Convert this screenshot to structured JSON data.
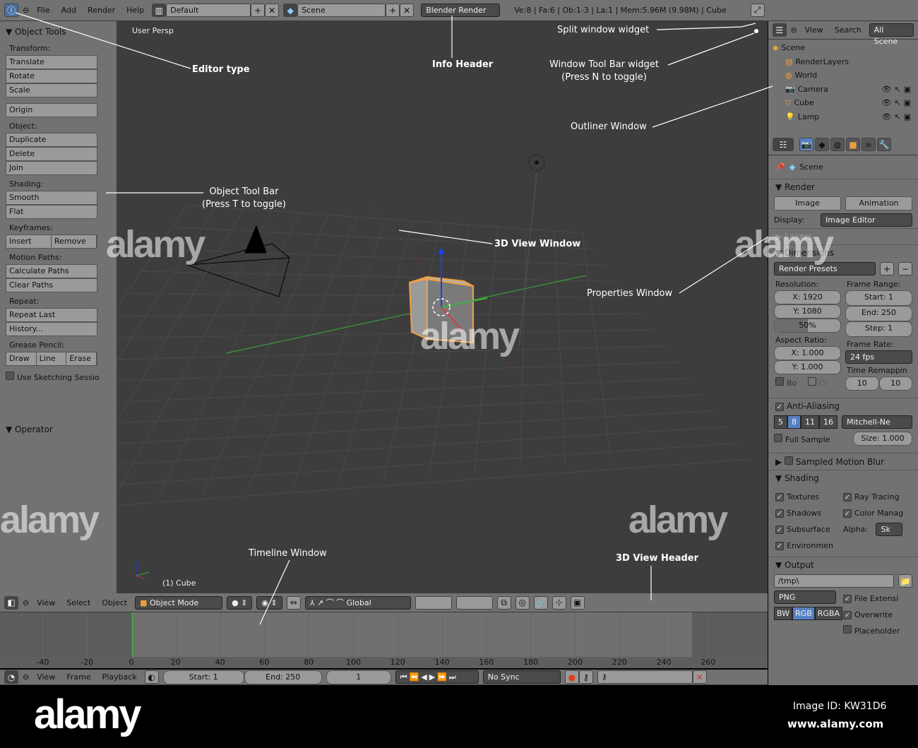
{
  "info_header": {
    "menus": [
      "File",
      "Add",
      "Render",
      "Help"
    ],
    "layout": "Default",
    "scene": "Scene",
    "engine": "Blender Render",
    "stats": "Ve:8 | Fa:6 | Ob:1-3 | La:1 | Mem:5.96M (9.98M) | Cube"
  },
  "toolbar": {
    "title": "Object Tools",
    "sections": [
      {
        "label": "Transform:",
        "buttons": [
          "Translate",
          "Rotate",
          "Scale"
        ]
      },
      {
        "label": "",
        "buttons": [
          "Origin"
        ]
      },
      {
        "label": "Object:",
        "buttons": [
          "Duplicate",
          "Delete",
          "Join"
        ]
      },
      {
        "label": "Shading:",
        "buttons": [
          "Smooth",
          "Flat"
        ]
      },
      {
        "label": "Keyframes:",
        "row": [
          "Insert",
          "Remove"
        ]
      },
      {
        "label": "Motion Paths:",
        "buttons": [
          "Calculate Paths",
          "Clear Paths"
        ]
      },
      {
        "label": "Repeat:",
        "buttons": [
          "Repeat Last",
          "History..."
        ]
      },
      {
        "label": "Grease Pencil:",
        "row": [
          "Draw",
          "Line",
          "Erase"
        ]
      }
    ],
    "sketching": "Use Sketching Sessio",
    "operator": "Operator"
  },
  "view3d": {
    "persp": "User Persp",
    "object_label": "(1) Cube"
  },
  "view3d_header": {
    "menus": [
      "View",
      "Select",
      "Object"
    ],
    "mode": "Object Mode",
    "orientation": "Global"
  },
  "timeline": {
    "ticks": [
      "-40",
      "-20",
      "0",
      "20",
      "40",
      "60",
      "80",
      "100",
      "120",
      "140",
      "160",
      "180",
      "200",
      "220",
      "240",
      "260"
    ],
    "current_frame": 0,
    "menus": [
      "View",
      "Frame",
      "Playback"
    ],
    "start": "Start: 1",
    "end": "End: 250",
    "frame": "1",
    "sync": "No Sync"
  },
  "outliner": {
    "menus": [
      "View",
      "Search"
    ],
    "filter": "All Scene",
    "items": [
      "Scene",
      "RenderLayers",
      "World",
      "Camera",
      "Cube",
      "Lamp"
    ]
  },
  "properties": {
    "context": "Scene",
    "render": {
      "title": "Render",
      "image": "Image",
      "animation": "Animation",
      "display_label": "Display:",
      "display": "Image Editor"
    },
    "layers": "Layers",
    "dimensions": {
      "title": "Dimensions",
      "presets": "Render Presets",
      "res_label": "Resolution:",
      "res_x": "X: 1920",
      "res_y": "Y: 1080",
      "res_pct": "50%",
      "res_pct_value": 50,
      "range_label": "Frame Range:",
      "start": "Start: 1",
      "end": "End: 250",
      "step": "Step: 1",
      "aspect_label": "Aspect Ratio:",
      "asp_x": "X: 1.000",
      "asp_y": "Y: 1.000",
      "rate_label": "Frame Rate:",
      "fps": "24 fps",
      "remap_label": "Time Remappin",
      "remap_a": "10",
      "remap_b": "10",
      "bo": "Bo",
      "cr": "Cr"
    },
    "aa": {
      "title": "Anti-Aliasing",
      "samples": [
        "5",
        "8",
        "11",
        "16"
      ],
      "selected": "8",
      "filter": "Mitchell-Ne",
      "full": "Full Sample",
      "size": "Size: 1.000"
    },
    "motion_blur": "Sampled Motion Blur",
    "shading": {
      "title": "Shading",
      "left": [
        "Textures",
        "Shadows",
        "Subsurface",
        "Environmen"
      ],
      "right": [
        "Ray Tracing",
        "Color Manag"
      ],
      "alpha_label": "Alpha:",
      "alpha": "Sk"
    },
    "output": {
      "title": "Output",
      "path": "/tmp\\",
      "format": "PNG",
      "modes": [
        "BW",
        "RGB",
        "RGBA"
      ],
      "mode_selected": "RGB",
      "checks": [
        "File Extensi",
        "Overwrite",
        "Placeholder"
      ]
    }
  },
  "annotations": {
    "editor_type": "Editor type",
    "info_header": "Info Header",
    "split": "Split window widget",
    "toolbar_widget_1": "Window Tool Bar widget",
    "toolbar_widget_2": "(Press N to toggle)",
    "outliner": "Outliner Window",
    "object_tool_1": "Object Tool Bar",
    "object_tool_2": "(Press T to toggle)",
    "view3d": "3D View Window",
    "properties": "Properties Window",
    "timeline": "Timeline Window",
    "view3d_header": "3D View Header"
  },
  "footer": {
    "logo": "alamy",
    "image_id": "Image ID: KW31D6",
    "url": "www.alamy.com"
  },
  "colors": {
    "panel": "#727272",
    "viewport": "#3d3d3d",
    "selected": "#5680c2",
    "x_axis": "#c03030",
    "y_axis": "#40a040",
    "z_axis": "#2040e0",
    "cube_outline": "#f0a040"
  }
}
